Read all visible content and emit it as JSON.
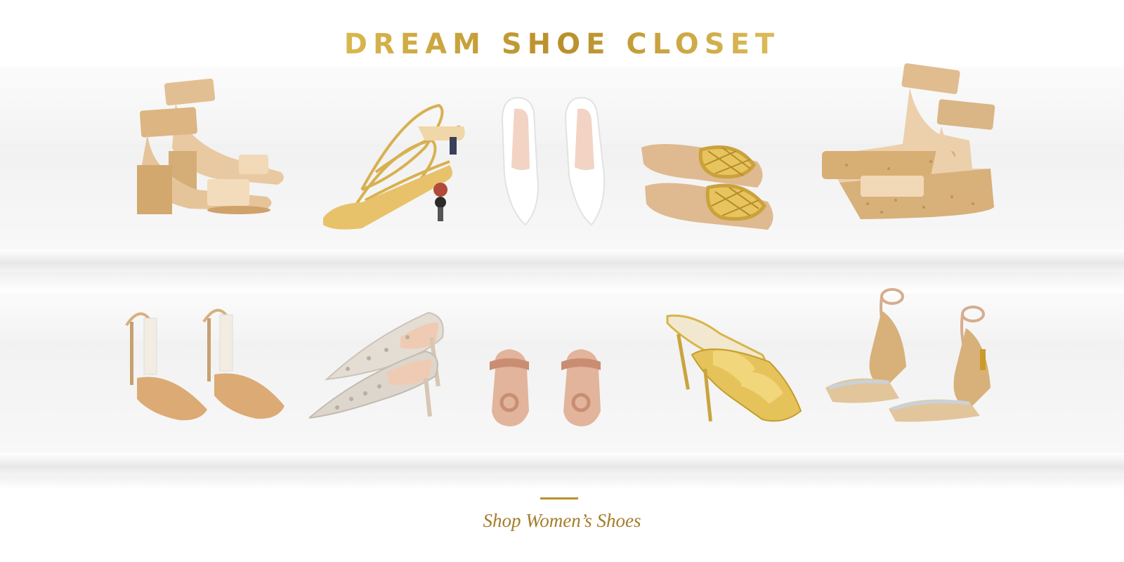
{
  "page": {
    "title": "DREAM SHOE CLOSET",
    "cta_label": "Shop Women’s Shoes"
  },
  "colors": {
    "gold": "#c9a13b",
    "gold_dark": "#a47d2a",
    "cork": "#d9b27c",
    "nude": "#e6c39b",
    "white_leather": "#ffffff",
    "rose": "#d8a58c",
    "snakeskin": "#d9d2c9"
  },
  "shelves": [
    {
      "items": [
        {
          "name": "nude-ankle-strap-cork-heel-sandals",
          "icon": "sandal-heel-icon"
        },
        {
          "name": "gold-strappy-sculpted-heel-sandals",
          "icon": "sandal-strappy-icon"
        },
        {
          "name": "white-pointed-pumps",
          "icon": "pump-icon"
        },
        {
          "name": "gold-woven-flat-slides",
          "icon": "slide-flat-icon"
        },
        {
          "name": "nude-ankle-strap-cork-platform-wedges",
          "icon": "wedge-platform-icon"
        }
      ]
    },
    {
      "items": [
        {
          "name": "tan-suede-slingback-pumps",
          "icon": "slingback-icon"
        },
        {
          "name": "snakeskin-pointed-mules",
          "icon": "mule-icon"
        },
        {
          "name": "rose-toe-ring-flat-sandals",
          "icon": "toe-ring-sandal-icon"
        },
        {
          "name": "gold-metallic-heel-slides",
          "icon": "heel-slide-icon"
        },
        {
          "name": "nude-strappy-cork-wedge-sandals",
          "icon": "wedge-strappy-icon"
        }
      ]
    }
  ]
}
